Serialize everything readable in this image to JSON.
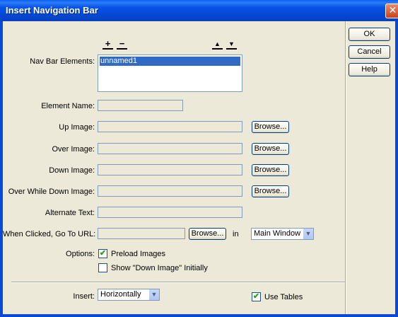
{
  "window": {
    "title": "Insert Navigation Bar",
    "close_glyph": "✕"
  },
  "toolbar": {
    "add_glyph": "+",
    "remove_glyph": "−",
    "up_glyph": "▲",
    "down_glyph": "▼"
  },
  "nav_elements": {
    "label": "Nav Bar Elements:",
    "items": [
      "unnamed1"
    ]
  },
  "labels": {
    "element_name": "Element Name:",
    "up_image": "Up Image:",
    "over_image": "Over Image:",
    "down_image": "Down Image:",
    "over_while_down_image": "Over While Down Image:",
    "alternate_text": "Alternate Text:",
    "when_clicked": "When Clicked, Go To URL:",
    "in": "in",
    "options": "Options:",
    "insert": "Insert:"
  },
  "buttons": {
    "browse": "Browse...",
    "ok": "OK",
    "cancel": "Cancel",
    "help": "Help"
  },
  "selects": {
    "target_window": "Main Window",
    "insert": "Horizontally"
  },
  "checkboxes": {
    "preload_images": {
      "label": "Preload Images",
      "checked": true
    },
    "show_down_image": {
      "label": "Show \"Down Image\" Initially",
      "checked": false
    },
    "use_tables": {
      "label": "Use Tables",
      "checked": true
    }
  },
  "checkmark_glyph": "✔",
  "colors": {
    "title_bar": "#0a5ef4",
    "dialog_bg": "#ece9d8",
    "selection": "#316ac5"
  }
}
